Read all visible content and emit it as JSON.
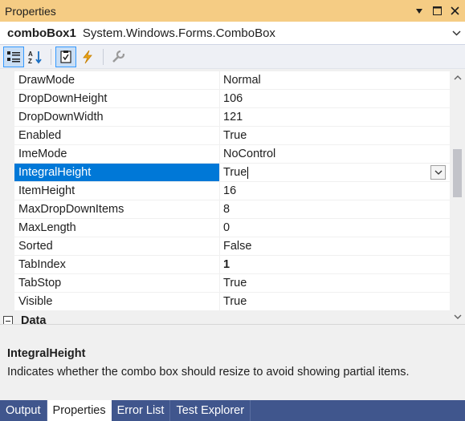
{
  "window": {
    "title": "Properties",
    "controls": {
      "dropdown_icon": "triangle-down-icon",
      "pin_icon": "square-icon",
      "close_label": "✕"
    }
  },
  "selector": {
    "object_name": "comboBox1",
    "object_type": "System.Windows.Forms.ComboBox"
  },
  "toolbar": {
    "buttons": [
      "categorized-icon",
      "alphabetical-icon",
      "properties-icon",
      "events-icon",
      "property-pages-icon"
    ]
  },
  "grid": {
    "rows": [
      {
        "name": "DrawMode",
        "value": "Normal"
      },
      {
        "name": "DropDownHeight",
        "value": "106"
      },
      {
        "name": "DropDownWidth",
        "value": "121"
      },
      {
        "name": "Enabled",
        "value": "True"
      },
      {
        "name": "ImeMode",
        "value": "NoControl"
      },
      {
        "name": "IntegralHeight",
        "value": "True",
        "selected": true
      },
      {
        "name": "ItemHeight",
        "value": "16"
      },
      {
        "name": "MaxDropDownItems",
        "value": "8"
      },
      {
        "name": "MaxLength",
        "value": "0"
      },
      {
        "name": "Sorted",
        "value": "False"
      },
      {
        "name": "TabIndex",
        "value": "1",
        "bold": true
      },
      {
        "name": "TabStop",
        "value": "True"
      },
      {
        "name": "Visible",
        "value": "True"
      }
    ],
    "category": {
      "label": "Data"
    }
  },
  "description": {
    "title": "IntegralHeight",
    "text": "Indicates whether the combo box should resize to avoid showing partial items."
  },
  "tabs": [
    {
      "label": "Output"
    },
    {
      "label": "Properties",
      "active": true
    },
    {
      "label": "Error List"
    },
    {
      "label": "Test Explorer"
    }
  ],
  "colors": {
    "titlebar": "#f5cc84",
    "selection": "#0078d7",
    "tab_strip": "#40568d"
  }
}
